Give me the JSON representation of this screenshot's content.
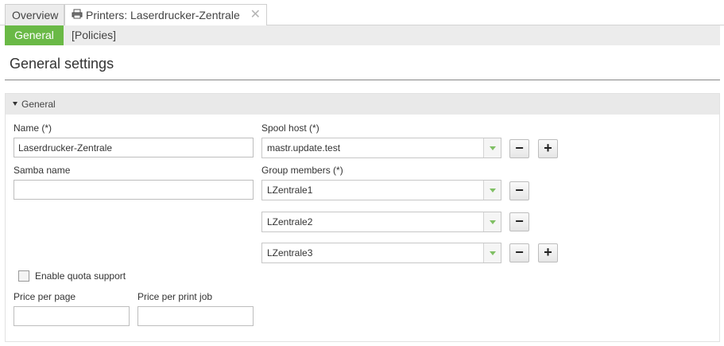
{
  "top_tabs": {
    "overview": "Overview",
    "printers": "Printers: Laserdrucker-Zentrale",
    "close_glyph": "✕"
  },
  "sub_tabs": {
    "general": "General",
    "policies": "[Policies]"
  },
  "page_title": "General settings",
  "section": {
    "title": "General",
    "name_label": "Name (*)",
    "name_value": "Laserdrucker-Zentrale",
    "samba_label": "Samba name",
    "samba_value": "",
    "spool_label": "Spool host (*)",
    "spool_value": "mastr.update.test",
    "group_label": "Group members (*)",
    "group_members": [
      "LZentrale1",
      "LZentrale2",
      "LZentrale3"
    ],
    "quota_label": "Enable quota support",
    "quota_checked": false,
    "price_page_label": "Price per page",
    "price_page_value": "",
    "price_job_label": "Price per print job",
    "price_job_value": ""
  },
  "buttons": {
    "remove_glyph": "−",
    "add_glyph": "+"
  },
  "colors": {
    "accent": "#6ab946",
    "combo_arrow": "#7fbf63"
  },
  "icons": {
    "printer": "printer-icon",
    "close": "close-icon",
    "expand": "triangle-down-icon"
  }
}
